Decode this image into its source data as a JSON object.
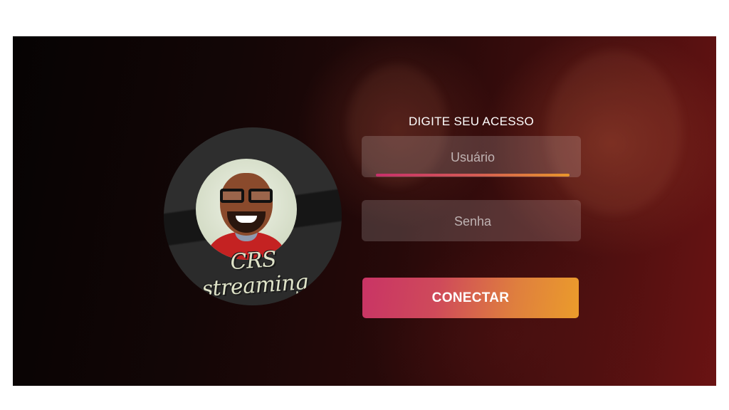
{
  "login": {
    "title": "DIGITE SEU ACESSO",
    "username_placeholder": "Usuário",
    "username_value": "",
    "password_placeholder": "Senha",
    "password_value": "",
    "connect_label": "CONECTAR"
  },
  "logo": {
    "text": "CRS streaming",
    "icon": "avatar-caricature"
  },
  "colors": {
    "accent_start": "#c93465",
    "accent_end": "#eb9c2b",
    "background_dark": "#060303",
    "background_red": "#6a1313"
  }
}
